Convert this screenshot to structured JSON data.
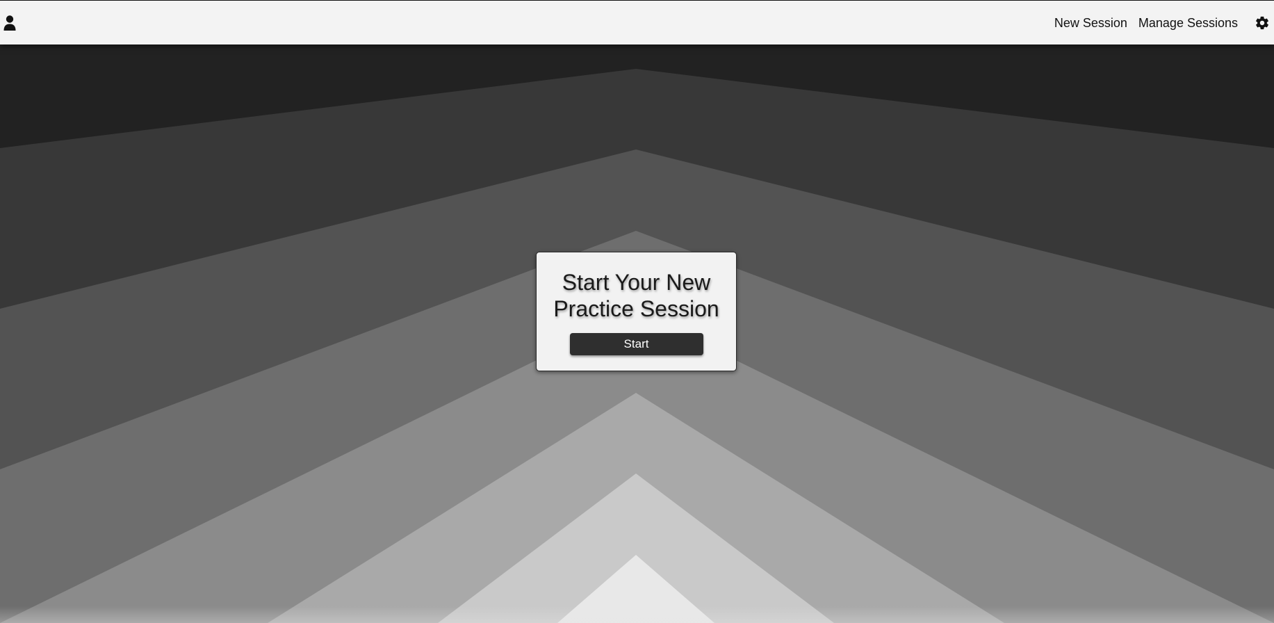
{
  "navbar": {
    "profile_icon": "user-icon",
    "links": {
      "new_session": "New Session",
      "manage_sessions": "Manage Sessions"
    },
    "settings_icon": "gear-icon"
  },
  "card": {
    "title": "Start Your New Practice Session",
    "start_label": "Start"
  },
  "colors": {
    "navbar_bg": "#f3f3f3",
    "card_bg": "#f2f2f2",
    "button_bg": "#2f2f2f",
    "chevron_bands": [
      "#222222",
      "#383838",
      "#535353",
      "#6e6e6e",
      "#8b8b8b",
      "#a9a9a9",
      "#c9c9c9",
      "#e8e8e8"
    ]
  }
}
